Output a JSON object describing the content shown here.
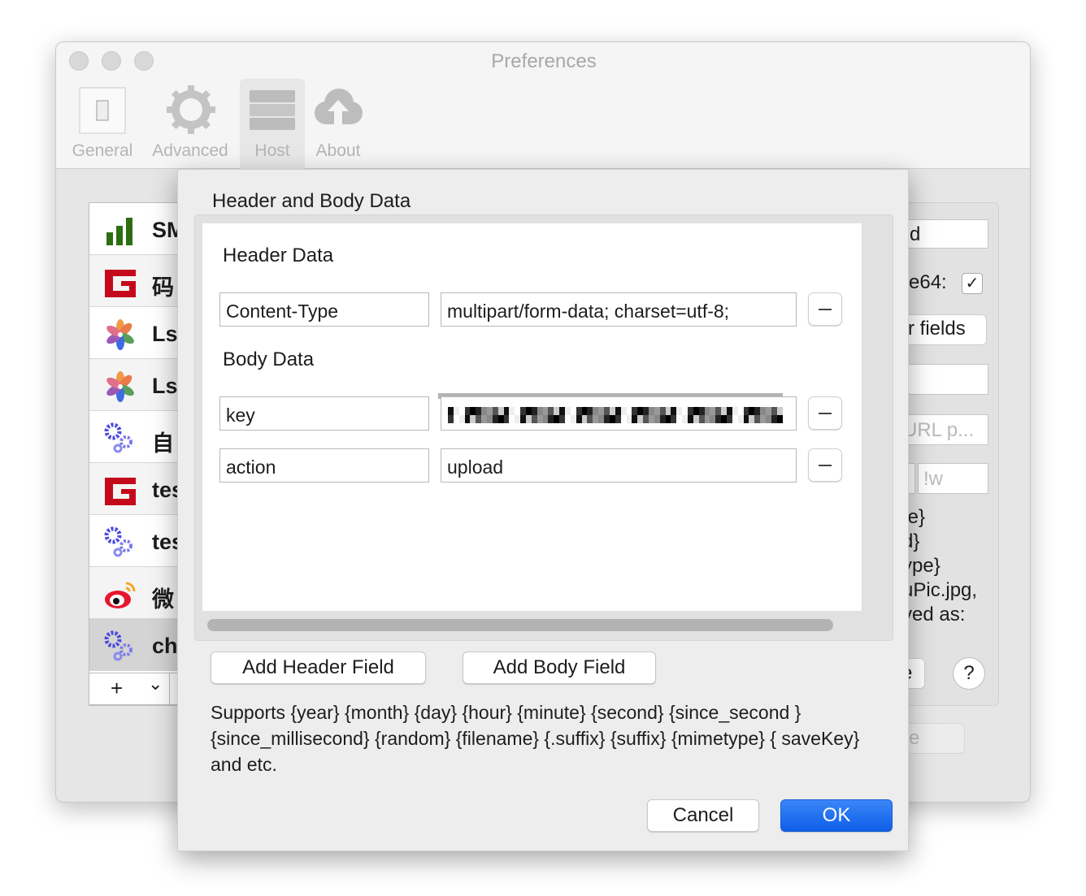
{
  "window": {
    "title": "Preferences"
  },
  "toolbar": {
    "items": [
      {
        "label": "General",
        "icon": "switch-icon"
      },
      {
        "label": "Advanced",
        "icon": "gear-icon"
      },
      {
        "label": "Host",
        "icon": "server-icon",
        "selected": true
      },
      {
        "label": "About",
        "icon": "cloud-upload-icon"
      }
    ]
  },
  "host_list": {
    "items": [
      {
        "label": "SM",
        "icon": "bar-chart-icon"
      },
      {
        "label": "码",
        "icon": "g-logo-icon"
      },
      {
        "label": "Ls",
        "icon": "flower-icon"
      },
      {
        "label": "Ls",
        "icon": "flower-icon"
      },
      {
        "label": "自",
        "icon": "gears-icon"
      },
      {
        "label": "tes",
        "icon": "g-logo-icon"
      },
      {
        "label": "tes",
        "icon": "gears-icon"
      },
      {
        "label": "微",
        "icon": "weibo-icon"
      },
      {
        "label": "ch",
        "icon": "gears-icon",
        "selected": true
      }
    ],
    "add_label": "+",
    "menu_label": "⌄"
  },
  "right_panel": {
    "field1": "d",
    "base64_label": "e64:",
    "base64_checked": true,
    "fields_button": "r fields",
    "url_placeholder": "URL p...",
    "suffix_placeholder": "!w",
    "lines": [
      "te}",
      "d}",
      "ype}",
      "uPic.jpg,",
      "ved as:"
    ],
    "button_partial": "e",
    "help": "?",
    "bottom_button_partial": "e"
  },
  "dialog": {
    "title": "Header and Body Data",
    "header_section": "Header Data",
    "body_section": "Body Data",
    "header_fields": [
      {
        "key": "Content-Type",
        "value": "multipart/form-data; charset=utf-8;"
      }
    ],
    "body_fields": [
      {
        "key": "key",
        "value": ""
      },
      {
        "key": "action",
        "value": "upload"
      }
    ],
    "add_header": "Add Header Field",
    "add_body": "Add Body Field",
    "help_text": "Supports {year} {month} {day} {hour} {minute} {second} {since_second } {since_millisecond} {random} {filename} {.suffix} {suffix} {mimetype} { saveKey} and etc.",
    "cancel": "Cancel",
    "ok": "OK",
    "accent": "#1a66ee"
  }
}
